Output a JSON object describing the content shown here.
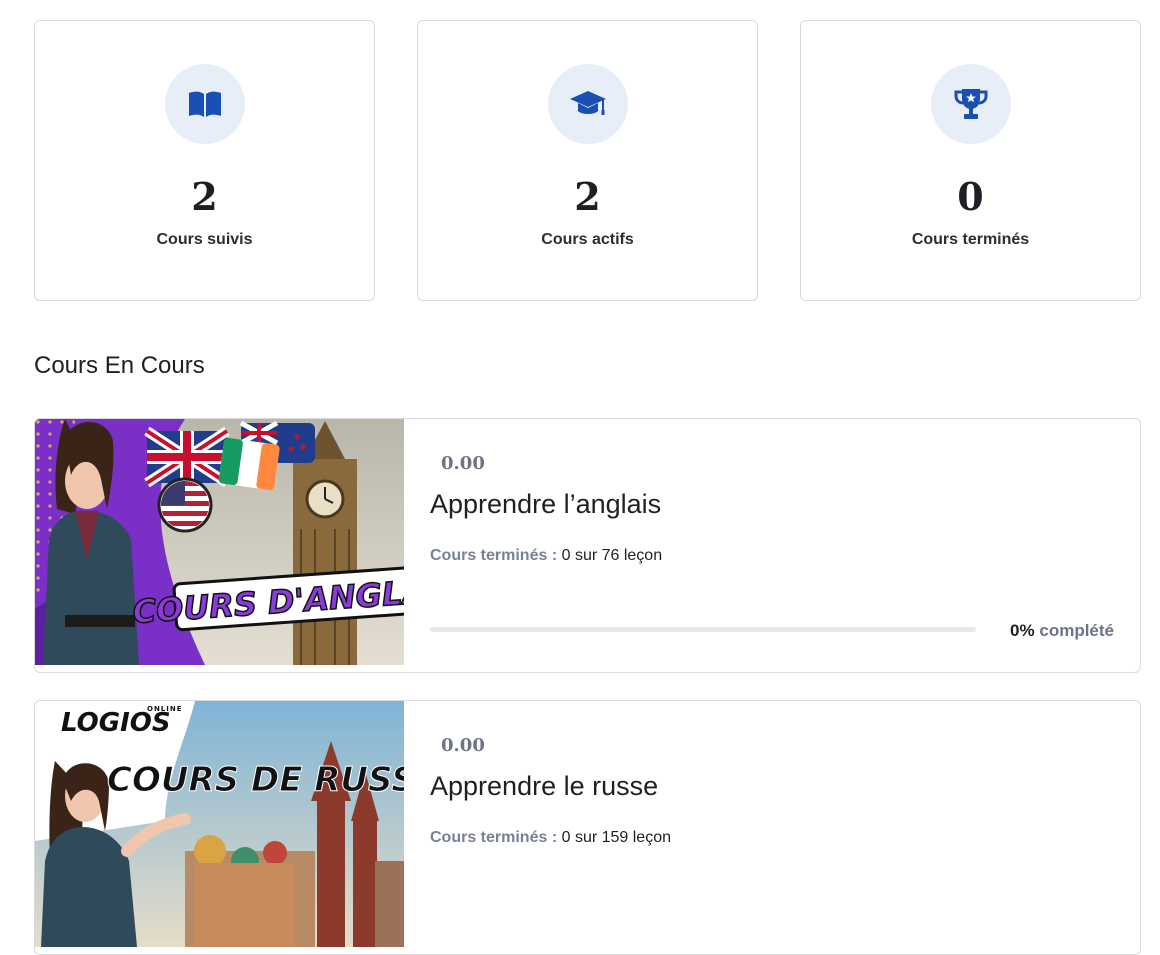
{
  "stats": [
    {
      "icon": "book-open-icon",
      "value": "2",
      "label": "Cours suivis"
    },
    {
      "icon": "graduation-cap-icon",
      "value": "2",
      "label": "Cours actifs"
    },
    {
      "icon": "trophy-icon",
      "value": "0",
      "label": "Cours terminés"
    }
  ],
  "section_title": "Cours En Cours",
  "courses": [
    {
      "price": "0.00",
      "title": "Apprendre l’anglais",
      "progress_label": "Cours terminés :",
      "progress_value": "0 sur 76 leçon",
      "percent_text": "0%",
      "percent_word": "complété",
      "progress_fraction": 0,
      "thumb_text": "COURS D'ANGLAIS"
    },
    {
      "price": "0.00",
      "title": "Apprendre le russe",
      "progress_label": "Cours terminés :",
      "progress_value": "0 sur 159 leçon",
      "thumb_text": "COURS DE RUSSE",
      "thumb_logo": "LOGIOS",
      "thumb_logo_small": "ONLINE"
    }
  ],
  "colors": {
    "accent": "#1a4fb4",
    "icon_bg": "#e8eef8",
    "muted": "#6e7486"
  }
}
